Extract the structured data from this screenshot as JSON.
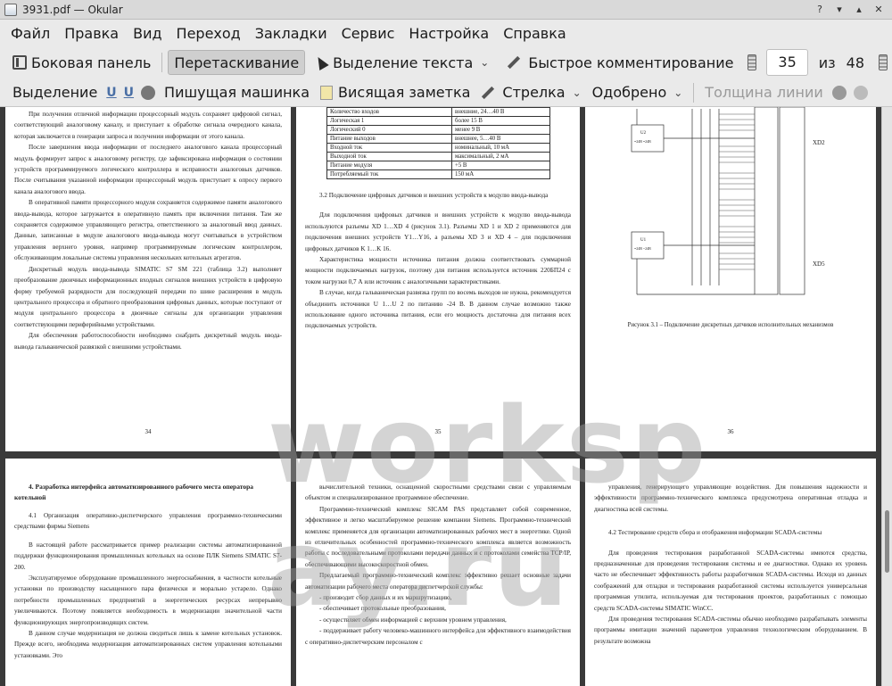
{
  "window": {
    "title": "3931.pdf  — Okular"
  },
  "menu": [
    "Файл",
    "Правка",
    "Вид",
    "Переход",
    "Закладки",
    "Сервис",
    "Настройка",
    "Справка"
  ],
  "toolbar1": {
    "side_panel": "Боковая панель",
    "drag": "Перетаскивание",
    "text_select": "Выделение текста",
    "quick_comment": "Быстрое комментирование",
    "page_current": "35",
    "page_of": "из",
    "page_total": "48"
  },
  "toolbar2": {
    "highlight": "Выделение",
    "typewriter": "Пишущая машинка",
    "hanging_note": "Висящая заметка",
    "arrow": "Стрелка",
    "stamp": "Одобрено",
    "line_width": "Толщина линии"
  },
  "watermark": "worksp ay.ru",
  "pages": {
    "p34": {
      "paras": [
        "При получении отличной информации процессорный модуль сохраняет цифровой сигнал, соответствующий аналоговому каналу, и приступает к обработке сигнала очередного канала, которая заключается в генерации запроса и получении информации от этого канала.",
        "После завершения ввода информации от последнего аналогового канала процессорный модуль формирует запрос к аналоговому регистру, где зафиксирована информация о состоянии устройств программируемого логического контроллера и исправности аналоговых датчиков. После считывания указанной информации процессорный модуль приступает к опросу первого канала аналогового ввода.",
        "В оперативной памяти процессорного модуля сохраняется содержимое памяти аналогового ввода-вывода, которое загружается в оперативную память при включении питания. Там же сохраняется содержимое управляющего регистра, ответственного за аналоговый ввод данных. Данные, записанные в модуле аналогового ввода-вывода могут считываться в устройством управления верхнего уровня, например программируемым логическим контроллером, обслуживающим локальные системы управления нескольких котельных агрегатов.",
        "Дискретный модуль ввода-вывода SIMATIC S7 SM 221 (таблица 3.2) выполняет преобразование двоичных информационных входных сигналов внешних устройств в цифровую форму требуемой разрядности для последующей передачи по шине расширения в модуль центрального процессора и обратного преобразования цифровых данных, которые поступают от модуля центрального процессора в двоичные сигналы для организации управления соответствующими периферийными устройствами.",
        "Для обеспечения работоспособности необходимо снабдить дискретный модуль ввода-вывода гальванической развязкой с внешними устройствами."
      ],
      "num": "34"
    },
    "p35": {
      "table": [
        [
          "Количество входов",
          "внешние, 24…40 В"
        ],
        [
          "Логическая 1",
          "более 15 В"
        ],
        [
          "Логический 0",
          "менее 9 В"
        ],
        [
          "Питание выходов",
          "внешнее, 5…40 В"
        ],
        [
          "Входной ток",
          "номинальный, 10 мА"
        ],
        [
          "Выходной ток",
          "максимальный, 2 мА"
        ],
        [
          "Питание модуля",
          "+5 В"
        ],
        [
          "Потребляемый ток",
          "150 мА"
        ]
      ],
      "heading": "3.2 Подключение цифровых датчиков и внешних устройств к модулю ввода-вывода",
      "paras": [
        "Для подключения цифровых датчиков и внешних устройств к модулю ввода-вывода используются разъемы XD 1…XD 4 (рисунок 3.1). Разъемы XD 1 и XD 2 применяются для подключения внешних устройств Y1…Y16, а разъемы XD 3 и XD 4 – для подключения цифровых датчиков K 1…K 16.",
        "Характеристика мощности источника питания должна соответствовать суммарной мощности подключаемых нагрузок, поэтому для питания используется источник 220БП24 с током нагрузки 0,7 А или источник с аналогичными характеристиками.",
        "В случае, когда гальваническая развязка групп по восемь выходов не нужна, рекомендуется объединить источники U 1…U 2 по питанию -24 В. В данном случае возможно также использование одного источника питания, если его мощность достаточна для питания всех подключаемых устройств."
      ],
      "num": "35"
    },
    "p36": {
      "caption": "Рисунок 3.1 – Подключение дискретных датчиков исполнительных механизмов",
      "labels": [
        "XD2",
        "XD5",
        "U1",
        "U2",
        "=24B =24B",
        "=24B ~24B"
      ],
      "num": "36"
    },
    "p37": {
      "heading": "4. Разработка интерфейса автоматизированного рабочего места оператора котельной",
      "paras": [
        "4.1 Организация оперативно-диспетчерского управления программно-техническими средствами фирмы Siemens",
        "В настоящей работе рассматривается пример реализации системы автоматизированной поддержки функционирования промышленных котельных на основе ПЛК Siemens SIMATIC S7-200.",
        "Эксплуатируемое оборудование промышленного энергоснабжения, в частности котельные установки по производству насыщенного пара физически и морально устарело. Однако потребности промышленных предприятий в энергетических ресурсах непрерывно увеличиваются. Поэтому появляется необходимость в модернизации значительной части функционирующих энергопроизводящих систем.",
        "В данном случае модернизация не должна сводиться лишь к замене котельных установок. Прежде всего, необходима модернизация автоматизированных систем управления котельными установками. Это"
      ]
    },
    "p38": {
      "paras": [
        "вычислительной техники, оснащенной скоростными средствами связи с управляемым объектом и специализированное программное обеспечение.",
        "Программно-технический комплекс SICAM PAS представляет собой современное, эффективное и легко масштабируемое решение компании Siemens. Программно-технический комплекс применяется для организации автоматизированных рабочих мест в энергетике. Одной из отличительных особенностей программно-технического комплекса является возможность работы с последовательными протоколами передачи данных и с протоколами семейства TCP/IP, обеспечивающими высокоскоростной обмен.",
        "Предлагаемый программно-технический комплекс эффективно решает основные задачи автоматизации рабочего места оператора диспетчерской службы:"
      ],
      "list": [
        "- производит сбор данных и их маршрутизацию,",
        "- обеспечивает протокольные преобразования,",
        "- осуществляет обмен информацией с верхним уровнем управления,",
        "- поддерживает работу человеко-машинного интерфейса для эффективного взаимодействия с оперативно-диспетчерским персоналом с"
      ]
    },
    "p39": {
      "paras": [
        "управления, генерирующего управляющие воздействия. Для повышения надежности и эффективности программно-технического комплекса предусмотрена оперативная отладка и диагностика всей системы."
      ],
      "heading": "4.2 Тестирование средств сбора и отображения информации SCADA-системы",
      "paras2": [
        "Для проведения тестирования разработанной SCADA-системы имеются средства, предназначенные для проведения тестирования системы и ее диагностики. Однако их уровень часто не обеспечивает эффективность работы разработчиков SCADA-системы. Исходя из данных соображений для отладки и тестирования разработанной системы используется универсальная программная утилита, используемая для тестирования проектов, разработанных с помощью средств SCADA-системы SIMATIC WinCC.",
        "Для проведения тестирования SCADA-системы обычно необходимо разрабатывать элементы программы имитации значений параметров управления технологическим оборудованием. В результате возможна"
      ]
    }
  }
}
